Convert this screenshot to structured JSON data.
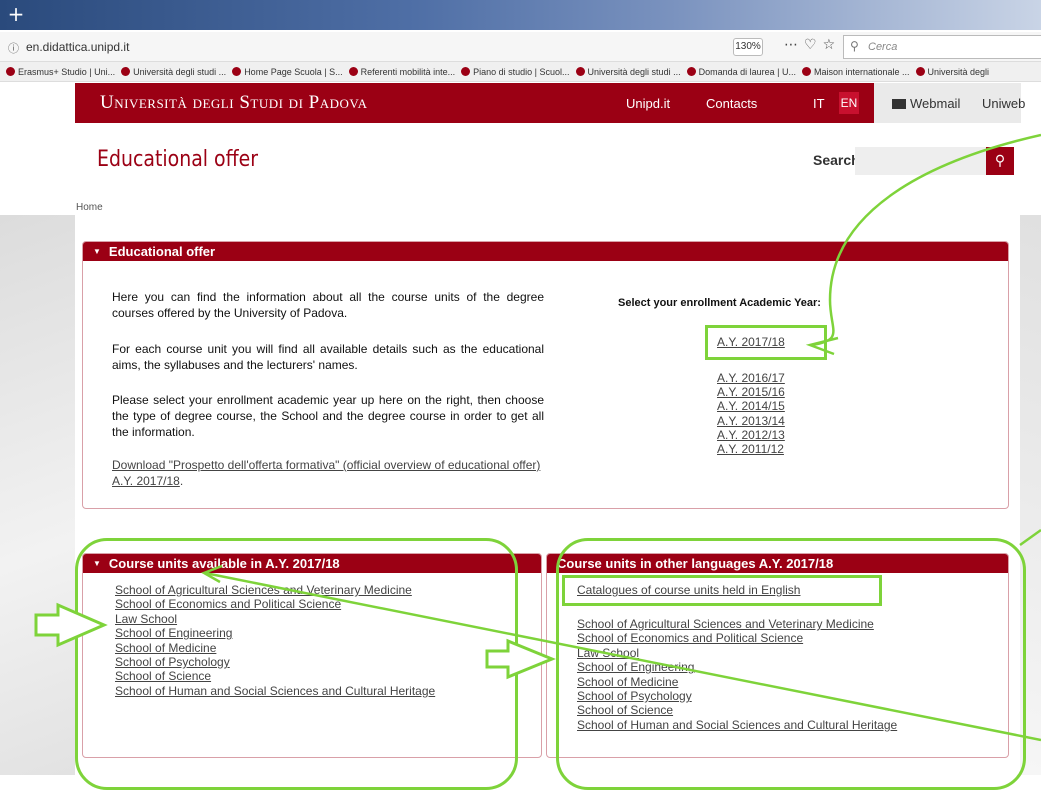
{
  "browser": {
    "url": "en.didattica.unipd.it",
    "zoom": "130%",
    "search_placeholder": "Cerca",
    "bookmarks": [
      "Erasmus+ Studio | Uni...",
      "Università degli studi ...",
      "Home Page Scuola | S...",
      "Referenti mobilità inte...",
      "Piano di studio | Scuol...",
      "Università degli studi ...",
      "Domanda di laurea | U...",
      "Maison internationale ...",
      "Università degli"
    ]
  },
  "header": {
    "logo": "Università degli Studi di Padova",
    "nav": [
      "Unipd.it",
      "Contacts"
    ],
    "lang_it": "IT",
    "lang_en": "EN",
    "webmail": "Webmail",
    "uniweb": "Uniweb"
  },
  "page": {
    "title": "Educational offer",
    "search_label": "Search",
    "breadcrumb": "Home"
  },
  "offer_panel": {
    "heading": "Educational offer",
    "paragraphs": [
      "Here you can find the information about all the course units of the degree courses offered by the University of Padova.",
      "For each course unit you will find all available details such as the educational aims, the syllabuses and the lecturers' names.",
      "Please select your enrollment academic year up here on the right, then choose the type of degree course, the School and the degree course in order to get all the information."
    ],
    "download_link": "Download \"Prospetto dell'offerta formativa\" (official overview of educational offer) A.Y. 2017/18",
    "download_suffix": ".",
    "year_heading": "Select your enrollment Academic Year:",
    "current_year": "A.Y. 2017/18",
    "years": [
      "A.Y. 2016/17",
      "A.Y. 2015/16",
      "A.Y. 2014/15",
      "A.Y. 2013/14",
      "A.Y. 2012/13",
      "A.Y. 2011/12"
    ]
  },
  "units_panel": {
    "heading": "Course units available in A.Y. 2017/18",
    "schools": [
      "School of Agricultural Sciences and Veterinary Medicine",
      "School of Economics and Political Science",
      "Law School",
      "School of Engineering",
      "School of Medicine",
      "School of Psychology",
      "School of Science",
      "School of Human and Social Sciences and Cultural Heritage"
    ]
  },
  "languages_panel": {
    "heading": "Course units in other languages A.Y. 2017/18",
    "english_catalogue": "Catalogues of course units held in English",
    "schools": [
      "School of Agricultural Sciences and Veterinary Medicine",
      "School of Economics and Political Science",
      "Law School",
      "School of Engineering",
      "School of Medicine",
      "School of Psychology",
      "School of Science",
      "School of Human and Social Sciences and Cultural Heritage"
    ]
  },
  "colors": {
    "brand_red": "#9b0014",
    "annotation_green": "#7ed33a"
  }
}
